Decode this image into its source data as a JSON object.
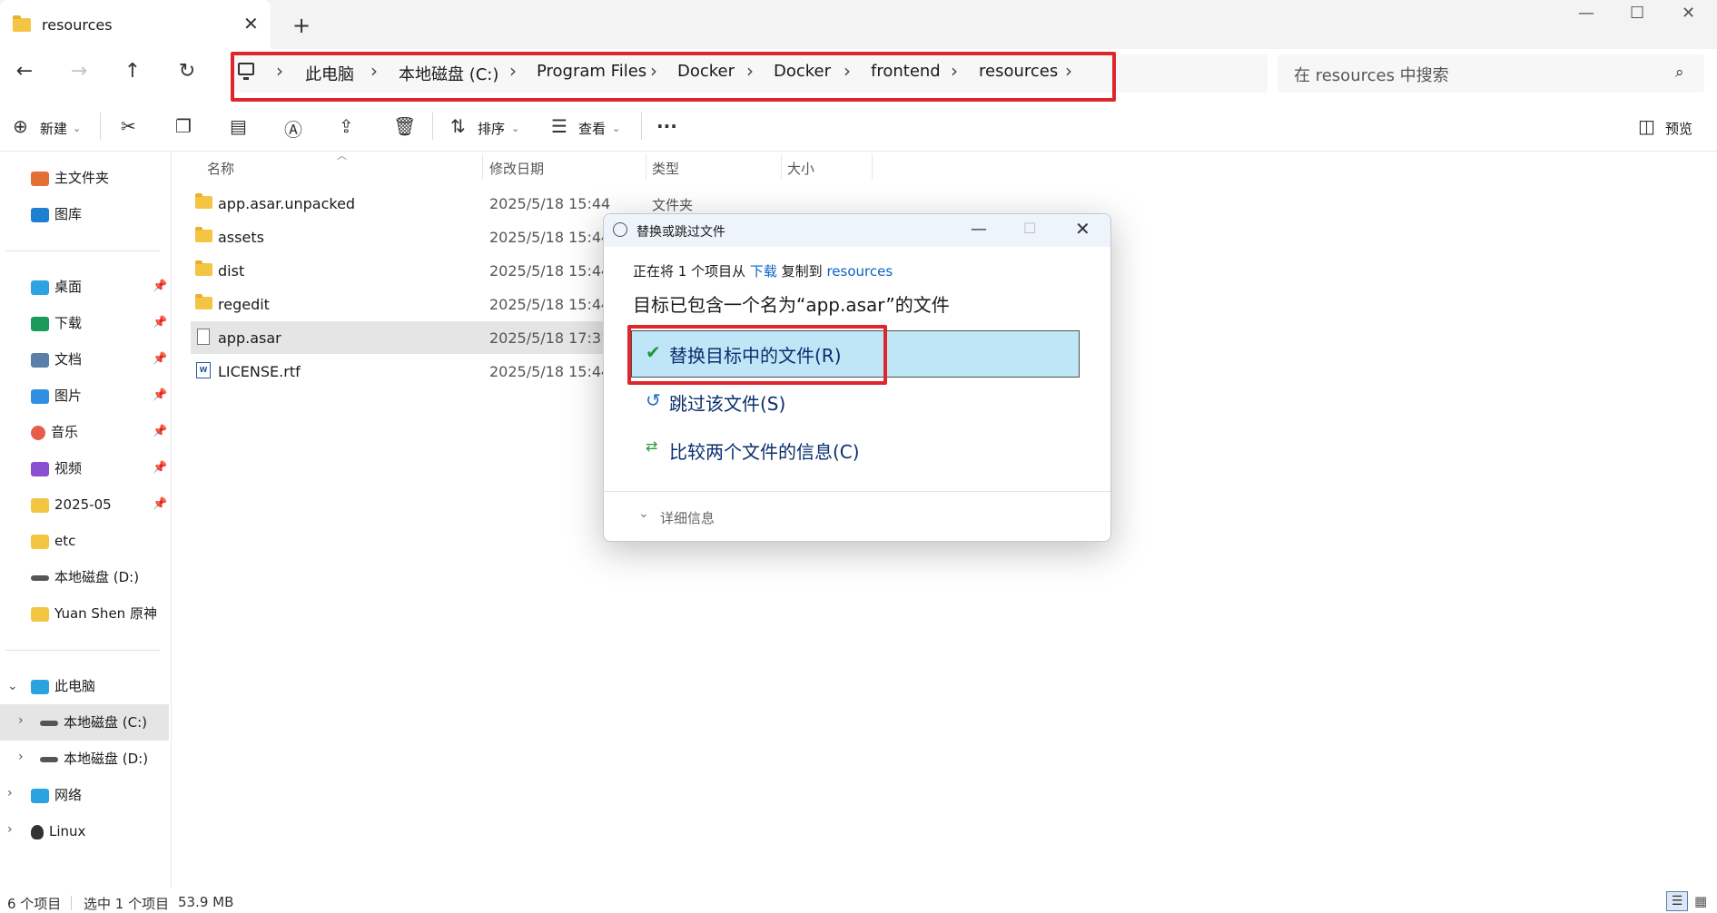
{
  "window": {
    "tab_label": "resources",
    "tab_close": "✕",
    "new_tab": "+",
    "minimize": "—",
    "maximize": "☐",
    "close": "✕"
  },
  "nav": {
    "back": "←",
    "forward": "→",
    "up": "↑",
    "refresh": "↻"
  },
  "breadcrumb": [
    "此电脑",
    "本地磁盘 (C:)",
    "Program Files",
    "Docker",
    "Docker",
    "frontend",
    "resources"
  ],
  "search": {
    "placeholder": "在 resources 中搜索"
  },
  "toolbar": {
    "new_label": "新建",
    "sort_label": "排序",
    "view_label": "查看",
    "more": "···",
    "preview_label": "预览"
  },
  "sidebar": {
    "quick": [
      {
        "label": "主文件夹",
        "icon": "home-icon",
        "color": "#e46f35"
      },
      {
        "label": "图库",
        "icon": "gallery-icon",
        "color": "#1e7fd1"
      }
    ],
    "pinned": [
      {
        "label": "桌面",
        "icon": "desktop-icon",
        "color": "#2aa3e0"
      },
      {
        "label": "下载",
        "icon": "download-icon",
        "color": "#1a9a5a"
      },
      {
        "label": "文档",
        "icon": "document-icon",
        "color": "#5b7fa6"
      },
      {
        "label": "图片",
        "icon": "pictures-icon",
        "color": "#2f8fe0"
      },
      {
        "label": "音乐",
        "icon": "music-icon",
        "color": "#e85d4a"
      },
      {
        "label": "视频",
        "icon": "video-icon",
        "color": "#8a4fd1"
      },
      {
        "label": "2025-05",
        "icon": "folder-icon",
        "color": "#f4c542"
      },
      {
        "label": "etc",
        "icon": "folder-icon",
        "color": "#f4c542"
      },
      {
        "label": "本地磁盘 (D:)",
        "icon": "drive-icon",
        "color": "#555555"
      },
      {
        "label": "Yuan Shen 原神",
        "icon": "folder-icon",
        "color": "#f4c542"
      }
    ],
    "tree": [
      {
        "label": "此电脑",
        "icon": "pc-icon",
        "color": "#2aa3e0"
      },
      {
        "label": "本地磁盘 (C:)",
        "icon": "drive-icon",
        "color": "#555555"
      },
      {
        "label": "本地磁盘 (D:)",
        "icon": "drive-icon",
        "color": "#555555"
      },
      {
        "label": "网络",
        "icon": "network-icon",
        "color": "#2aa3e0"
      },
      {
        "label": "Linux",
        "icon": "linux-icon",
        "color": "#333333"
      }
    ]
  },
  "columns": {
    "name": "名称",
    "date": "修改日期",
    "type": "类型",
    "size": "大小"
  },
  "files": [
    {
      "name": "app.asar.unpacked",
      "date": "2025/5/18 15:44",
      "type": "文件夹"
    },
    {
      "name": "assets",
      "date": "2025/5/18 15:44",
      "type": ""
    },
    {
      "name": "dist",
      "date": "2025/5/18 15:44",
      "type": ""
    },
    {
      "name": "regedit",
      "date": "2025/5/18 15:44",
      "type": ""
    },
    {
      "name": "app.asar",
      "date": "2025/5/18 17:31",
      "type": ""
    },
    {
      "name": "LICENSE.rtf",
      "date": "2025/5/18 15:44",
      "type": ""
    }
  ],
  "dialog": {
    "title": "替换或跳过文件",
    "copy_prefix": "正在将 1 个项目从",
    "copy_source": "下载",
    "copy_mid": "复制到",
    "copy_dest": "resources",
    "conflict_text": "目标已包含一个名为“app.asar”的文件",
    "option_replace": "替换目标中的文件(R)",
    "option_skip": "跳过该文件(S)",
    "option_compare": "比较两个文件的信息(C)",
    "details": "详细信息"
  },
  "status": {
    "item_count": "6 个项目",
    "selection": "选中 1 个项目",
    "size": "53.9 MB"
  },
  "colors": {
    "highlight_red": "#e0262b",
    "accent_blue": "#0a64c2",
    "option_bg": "#bfe6f7"
  }
}
